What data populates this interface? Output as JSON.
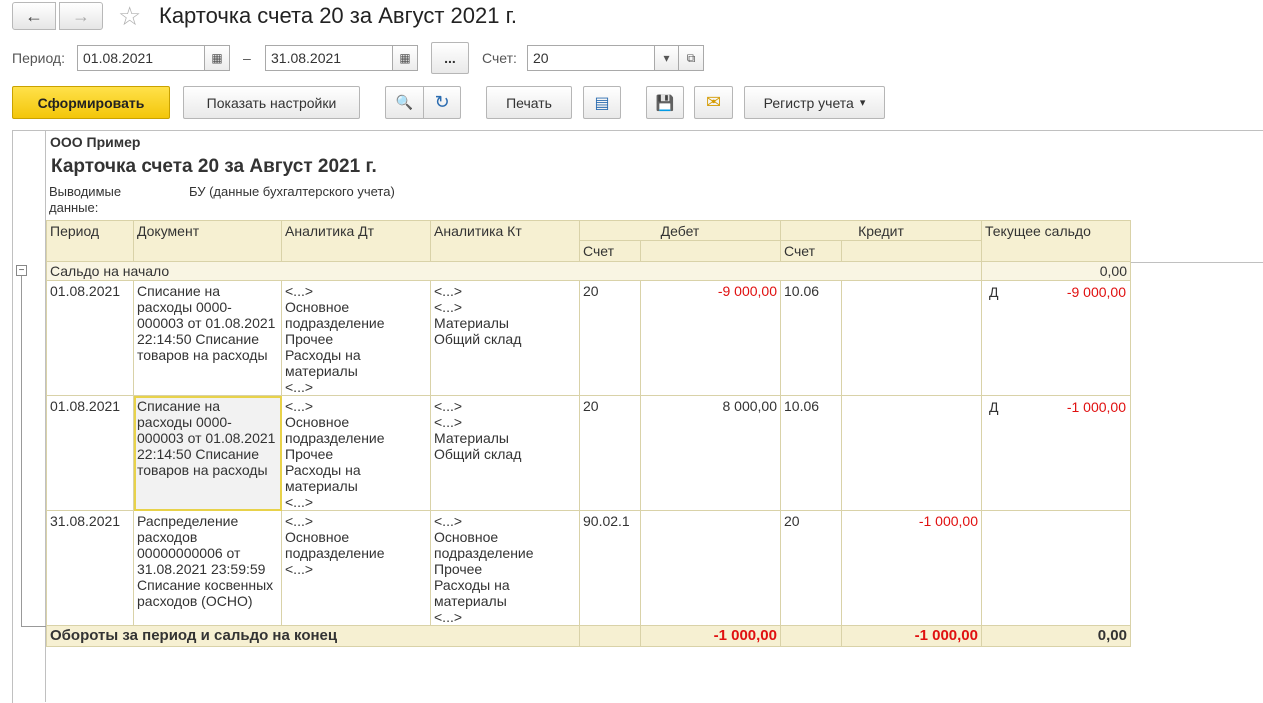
{
  "window": {
    "title": "Карточка счета 20 за Август 2021 г.",
    "back_icon": "←",
    "forward_icon": "→",
    "star_icon": "☆"
  },
  "filters": {
    "period_label": "Период:",
    "date_from": "01.08.2021",
    "date_dash": "–",
    "date_to": "31.08.2021",
    "more_label": "...",
    "account_label": "Счет:",
    "account_value": "20",
    "calendar_icon": "▦",
    "dropdown_icon": "▾",
    "open_icon": "⧉"
  },
  "toolbar": {
    "generate_label": "Сформировать",
    "settings_label": "Показать настройки",
    "print_label": "Печать",
    "register_label": "Регистр учета",
    "register_arrow": "▾",
    "search_icon": "🔍",
    "search_next_icon": "↻",
    "preview_icon": "▤",
    "save_icon": "💾",
    "mail_icon": "✉"
  },
  "report": {
    "org": "ООО Пример",
    "title": "Карточка счета 20 за Август 2021 г.",
    "output_label": "Выводимые данные:",
    "output_value": "БУ (данные бухгалтерского учета)",
    "headers": {
      "period": "Период",
      "document": "Документ",
      "analytics_dt": "Аналитика Дт",
      "analytics_kt": "Аналитика Кт",
      "debit": "Дебет",
      "credit": "Кредит",
      "balance": "Текущее сальдо",
      "debit_account": "Счет",
      "credit_account": "Счет"
    },
    "opening": {
      "label": "Сальдо на начало",
      "value": "0,00",
      "toggle": "−"
    },
    "rows": [
      {
        "period": "01.08.2021",
        "document": "Списание на расходы 0000-000003 от 01.08.2021 22:14:50 Списание товаров на расходы",
        "analytics_dt": "<...>\nОсновное подразделение\nПрочее\nРасходы на материалы\n<...>",
        "analytics_kt": "<...>\n<...>\nМатериалы\nОбщий склад",
        "debit_account": "20",
        "debit_amount": "-9 000,00",
        "credit_account": "10.06",
        "credit_amount": "",
        "balance_side": "Д",
        "balance_amount": "-9 000,00"
      },
      {
        "period": "01.08.2021",
        "document": "Списание на расходы 0000-000003 от 01.08.2021 22:14:50 Списание товаров на расходы",
        "analytics_dt": "<...>\nОсновное подразделение\nПрочее\nРасходы на материалы\n<...>",
        "analytics_kt": "<...>\n<...>\nМатериалы\nОбщий склад",
        "debit_account": "20",
        "debit_amount": "8 000,00",
        "credit_account": "10.06",
        "credit_amount": "",
        "balance_side": "Д",
        "balance_amount": "-1 000,00"
      },
      {
        "period": "31.08.2021",
        "document": "Распределение расходов 00000000006 от 31.08.2021 23:59:59 Списание косвенных расходов (ОСНО)",
        "analytics_dt": "<...>\nОсновное подразделение\n<...>",
        "analytics_kt": "<...>\nОсновное подразделение\nПрочее\nРасходы на материалы\n<...>",
        "debit_account": "90.02.1",
        "debit_amount": "",
        "credit_account": "20",
        "credit_amount": "-1 000,00",
        "balance_side": "",
        "balance_amount": ""
      }
    ],
    "totals": {
      "label": "Обороты за период и сальдо на конец",
      "debit": "-1 000,00",
      "credit": "-1 000,00",
      "balance": "0,00"
    }
  }
}
